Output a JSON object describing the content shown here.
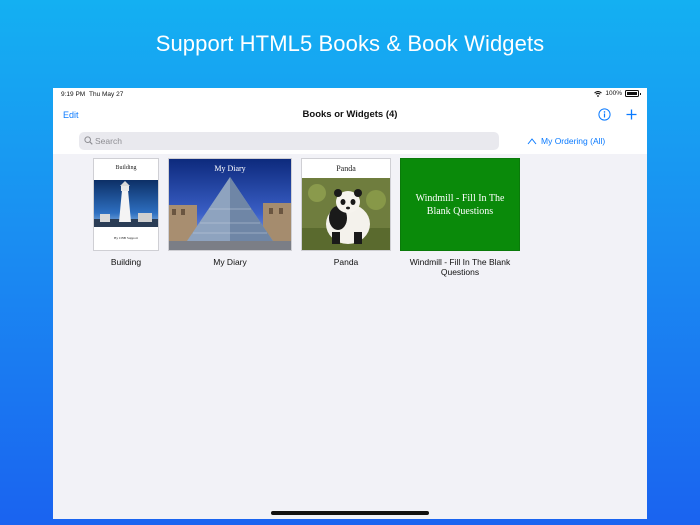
{
  "banner": {
    "headline": "Support HTML5 Books & Book Widgets"
  },
  "status_bar": {
    "time": "9:19 PM",
    "date": "Thu May 27",
    "battery": "100%"
  },
  "nav_bar": {
    "edit_label": "Edit",
    "title": "Books or Widgets (4)"
  },
  "search": {
    "placeholder": "Search",
    "value": ""
  },
  "ordering": {
    "label": "My Ordering (All)"
  },
  "books": [
    {
      "label": "Building",
      "cover_title": "Building",
      "cover_byline": "By CBB Support"
    },
    {
      "label": "My Diary",
      "cover_title": "My Diary"
    },
    {
      "label": "Panda",
      "cover_title": "Panda"
    },
    {
      "label": "Windmill - Fill In The Blank Questions",
      "cover_title": "Windmill - Fill In The Blank Questions"
    }
  ],
  "colors": {
    "accent": "#0a7aff",
    "widget_green": "#0a8a0a"
  }
}
